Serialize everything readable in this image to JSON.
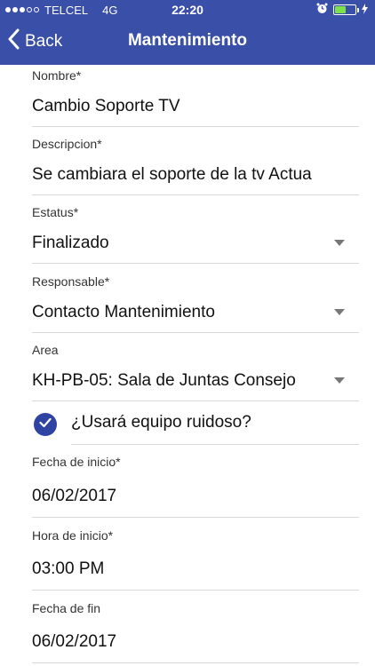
{
  "status_bar": {
    "carrier": "TELCEL",
    "network": "4G",
    "time": "22:20",
    "battery_level": 0.55
  },
  "nav": {
    "back_label": "Back",
    "title": "Mantenimiento"
  },
  "fields": {
    "nombre": {
      "label": "Nombre*",
      "value": "Cambio Soporte TV"
    },
    "descripcion": {
      "label": "Descripcion*",
      "value": "Se cambiara el soporte de la tv Actua"
    },
    "estatus": {
      "label": "Estatus*",
      "value": "Finalizado"
    },
    "responsable": {
      "label": "Responsable*",
      "value": "Contacto Mantenimiento"
    },
    "area": {
      "label": "Area",
      "value": "KH-PB-05: Sala de Juntas Consejo"
    },
    "fecha_inicio": {
      "label": "Fecha de inicio*",
      "value": "06/02/2017"
    },
    "hora_inicio": {
      "label": "Hora de inicio*",
      "value": "03:00 PM"
    },
    "fecha_fin": {
      "label": "Fecha de fin",
      "value": "06/02/2017"
    }
  },
  "equipo_ruidoso": {
    "label": "¿Usará equipo ruidoso?",
    "checked": true
  },
  "colors": {
    "header_bg": "#3a4fa8",
    "checkbox_fill": "#2f43a3",
    "battery_fill": "#7ee04b"
  }
}
